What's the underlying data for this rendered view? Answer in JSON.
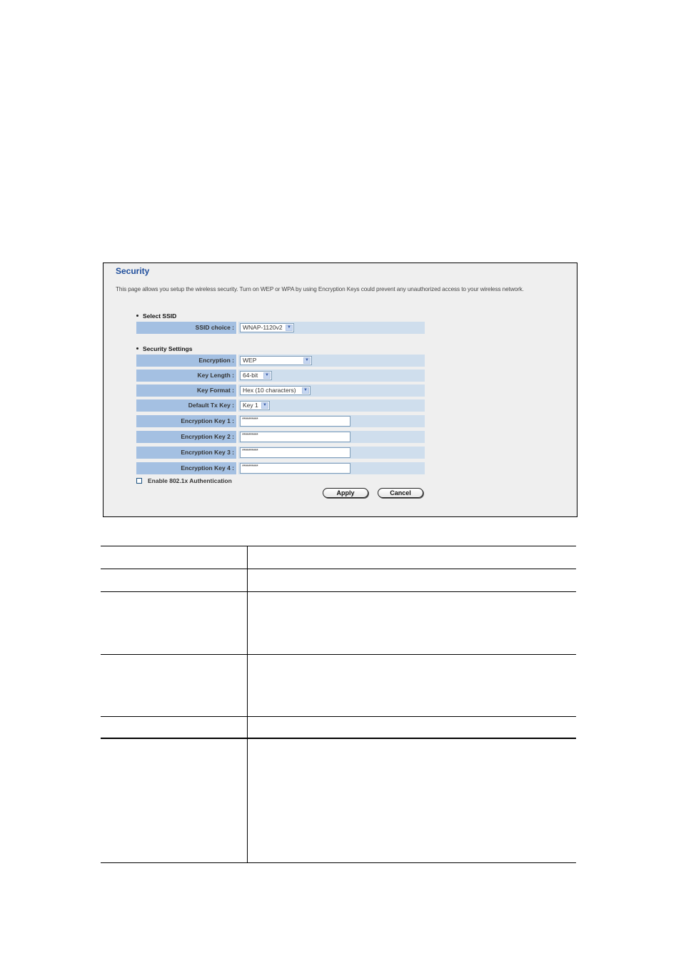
{
  "panel": {
    "title": "Security",
    "description": "This page allows you setup the wireless security. Turn on WEP or WPA by using Encryption Keys could prevent any unauthorized access to your wireless network.",
    "select_ssid": {
      "heading": "Select SSID",
      "ssid_choice": {
        "label": "SSID choice :",
        "value": "WNAP-1120v2"
      }
    },
    "security_settings": {
      "heading": "Security Settings",
      "encryption": {
        "label": "Encryption :",
        "value": "WEP"
      },
      "key_length": {
        "label": "Key Length :",
        "value": "64-bit"
      },
      "key_format": {
        "label": "Key Format :",
        "value": "Hex (10 characters)"
      },
      "default_tx_key": {
        "label": "Default Tx Key :",
        "value": "Key 1"
      },
      "keys": [
        {
          "label": "Encryption Key 1 :",
          "value": "**********"
        },
        {
          "label": "Encryption Key 2 :",
          "value": "**********"
        },
        {
          "label": "Encryption Key 3 :",
          "value": "**********"
        },
        {
          "label": "Encryption Key 4 :",
          "value": "**********"
        }
      ]
    },
    "enable_8021x": {
      "label": "Enable 802.1x Authentication",
      "checked": false
    },
    "buttons": {
      "apply": "Apply",
      "cancel": "Cancel"
    },
    "dropdown_arrow": "chevron-down-icon"
  },
  "colors": {
    "title": "#1f4e9c",
    "label_bg": "#a4c0e2",
    "value_bg": "#cfdeed",
    "panel_bg": "#efefef"
  },
  "doc_table": {
    "rows": [
      {
        "col1": "",
        "col2": ""
      },
      {
        "col1": "",
        "col2": ""
      },
      {
        "col1": "",
        "col2": ""
      },
      {
        "col1": "",
        "col2": ""
      },
      {
        "col1": "",
        "col2": ""
      },
      {
        "col1": "",
        "col2": ""
      }
    ]
  }
}
